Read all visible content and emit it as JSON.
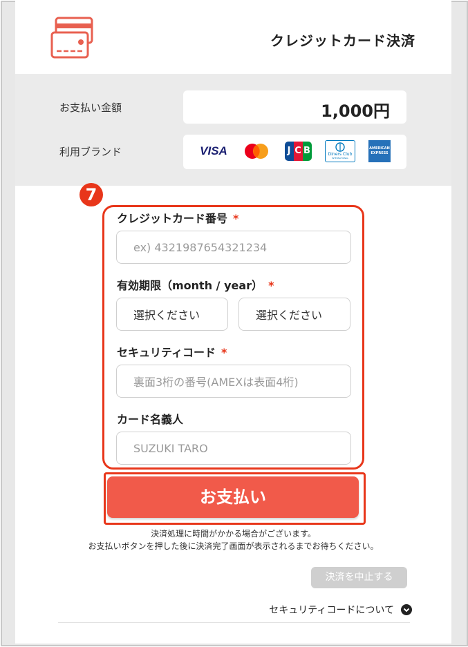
{
  "header": {
    "title": "クレジットカード決済",
    "icon": "credit-card-icon"
  },
  "summary": {
    "amount_label": "お支払い金額",
    "amount_value": "1,000円",
    "brand_label": "利用ブランド",
    "brands": [
      "VISA",
      "Mastercard",
      "JCB",
      "Diners Club",
      "American Express"
    ],
    "brand_text": {
      "visa": "VISA",
      "jcb": "JCB",
      "diners_line1": "Diners Club",
      "diners_line2": "INTERNATIONAL",
      "amex_line1": "AMERICAN",
      "amex_line2": "EXPRESS"
    }
  },
  "step_number": "7",
  "form": {
    "card_number": {
      "label": "クレジットカード番号",
      "required_mark": "*",
      "placeholder": "ex) 4321987654321234"
    },
    "expiry": {
      "label": "有効期限（month / year）",
      "required_mark": "*",
      "month_value": "選択ください",
      "year_value": "選択ください"
    },
    "security_code": {
      "label": "セキュリティコード",
      "required_mark": "*",
      "placeholder": "裏面3桁の番号(AMEXは表面4桁)"
    },
    "holder": {
      "label": "カード名義人",
      "placeholder": "SUZUKI TARO"
    }
  },
  "pay_button": "お支払い",
  "notes": [
    "決済処理に時間がかかる場合がございます。",
    "お支払いボタンを押した後に決済完了画面が表示されるまでお待ちください。"
  ],
  "cancel_button": "決済を中止する",
  "security_code_link": "セキュリティコードについて",
  "colors": {
    "accent": "#e8361a",
    "pay_button": "#f15a4a",
    "summary_bg": "#ebebeb",
    "cancel_bg": "#cfcfcf"
  }
}
